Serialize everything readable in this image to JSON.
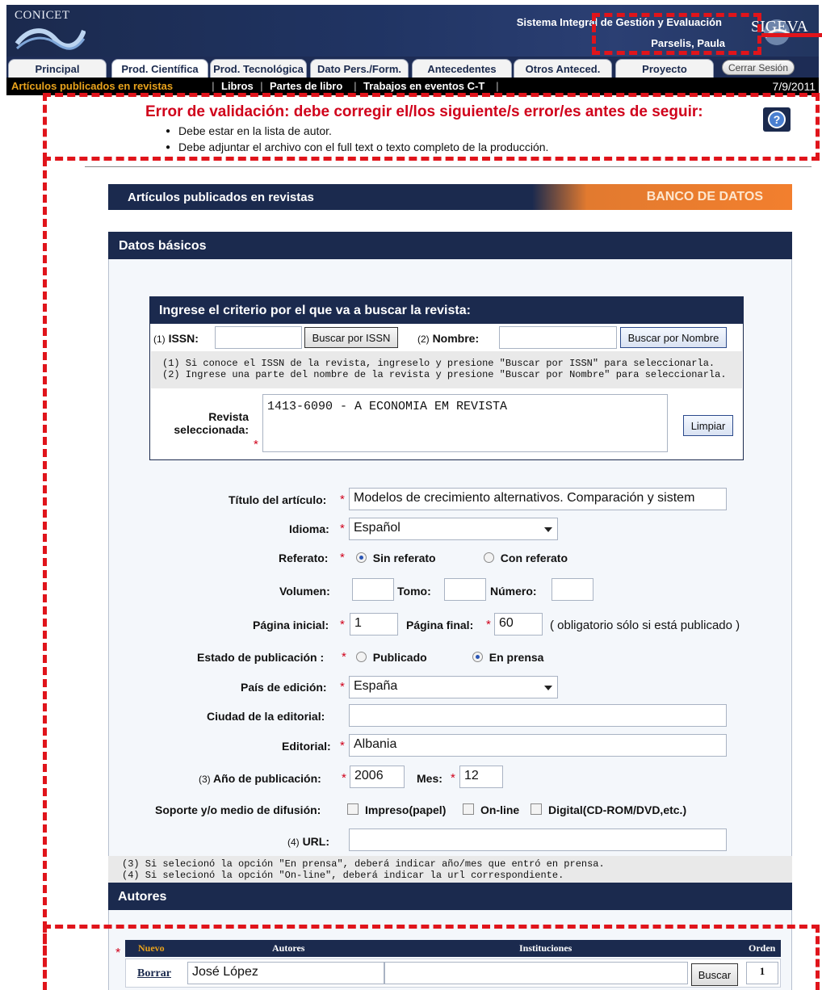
{
  "header": {
    "logo": "CONICET",
    "system_title": "Sistema Integral de Gestión y Evaluación",
    "user_name": "Parselis, Paula",
    "sigeva_logo": "SIGEVA"
  },
  "tabs": [
    "Principal",
    "Prod. Científica",
    "Prod. Tecnológica",
    "Dato Pers./Form.",
    "Antecedentes",
    "Otros Anteced.",
    "Proyecto"
  ],
  "logout": "Cerrar Sesión",
  "subnav": {
    "items": [
      "Artículos publicados en revistas",
      "Libros",
      "Partes de libro",
      "Trabajos en eventos C-T"
    ],
    "date": "7/9/2011"
  },
  "errors": {
    "title": "Error de validación: debe corregir el/los siguiente/s error/es antes de seguir:",
    "items": [
      "Debe estar en la lista de autor.",
      "Debe adjuntar el archivo con el full text o texto completo de la producción."
    ]
  },
  "banner": {
    "left": "Artículos publicados en revistas",
    "right": "BANCO DE DATOS"
  },
  "sections": {
    "basic": "Datos básicos",
    "authors": "Autores"
  },
  "search": {
    "title": "Ingrese el criterio por el que va a buscar la revista:",
    "issn_prefix": "(1)",
    "issn_label": "ISSN:",
    "issn_value": "",
    "btn_issn": "Buscar por ISSN",
    "name_prefix": "(2)",
    "name_label": "Nombre:",
    "name_value": "",
    "btn_name": "Buscar por Nombre",
    "hint1": "(1) Si conoce el ISSN de la revista, ingreselo y presione \"Buscar por ISSN\" para seleccionarla.",
    "hint2": "(2) Ingrese una parte del nombre de la revista y presione \"Buscar por Nombre\" para seleccionarla.",
    "selected_label_1": "Revista",
    "selected_label_2": "seleccionada:",
    "selected_value": "1413-6090 - A ECONOMIA EM REVISTA",
    "btn_clear": "Limpiar"
  },
  "form": {
    "titulo_label": "Título del artículo:",
    "titulo_value": "Modelos de crecimiento alternativos. Comparación y sistem",
    "idioma_label": "Idioma:",
    "idioma_value": "Español",
    "referato_label": "Referato:",
    "referato_opt1": "Sin referato",
    "referato_opt2": "Con referato",
    "referato_selected": "Sin referato",
    "volumen_label": "Volumen:",
    "tomo_label": "Tomo:",
    "numero_label": "Número:",
    "pag_ini_label": "Página inicial:",
    "pag_ini_value": "1",
    "pag_fin_label": "Página final:",
    "pag_fin_value": "60",
    "pag_note": "( obligatorio sólo si está publicado )",
    "estado_label": "Estado de publicación :",
    "estado_opt1": "Publicado",
    "estado_opt2": "En prensa",
    "estado_selected": "En prensa",
    "pais_label": "País de edición:",
    "pais_value": "España",
    "ciudad_label": "Ciudad de la editorial:",
    "ciudad_value": "",
    "editorial_label": "Editorial:",
    "editorial_value": "Albania",
    "anio_prefix": "(3)",
    "anio_label": "Año de publicación:",
    "anio_value": "2006",
    "mes_label": "Mes:",
    "mes_value": "12",
    "soporte_label": "Soporte y/o medio de difusión:",
    "soporte_opt1": "Impreso(papel)",
    "soporte_opt2": "On-line",
    "soporte_opt3": "Digital(CD-ROM/DVD,etc.)",
    "url_prefix": "(4)",
    "url_label": "URL:",
    "url_value": ""
  },
  "notes": {
    "n3": "(3) Si selecionó la opción \"En prensa\", deberá indicar año/mes que entró en prensa.",
    "n4": "(4) Si selecionó la opción \"On-line\", deberá indicar la url correspondiente."
  },
  "authors_table": {
    "headers": [
      "Nuevo",
      "Autores",
      "Instituciones",
      "Orden"
    ],
    "rows": [
      {
        "action": "Borrar",
        "author": "José López",
        "institution": "",
        "search": "Buscar",
        "order": "1"
      }
    ]
  },
  "colors": {
    "navy": "#1b2a4e",
    "error_red": "#d0021b",
    "orange": "#f27f2e",
    "annotation_dash": "#e0141b"
  }
}
